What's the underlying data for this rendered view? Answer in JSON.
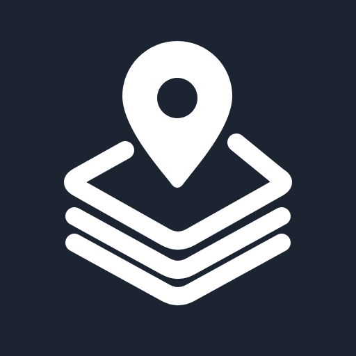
{
  "icon": {
    "name": "map-layers-pin-icon",
    "background_color": "#1b2430",
    "foreground_color": "#ffffff"
  }
}
